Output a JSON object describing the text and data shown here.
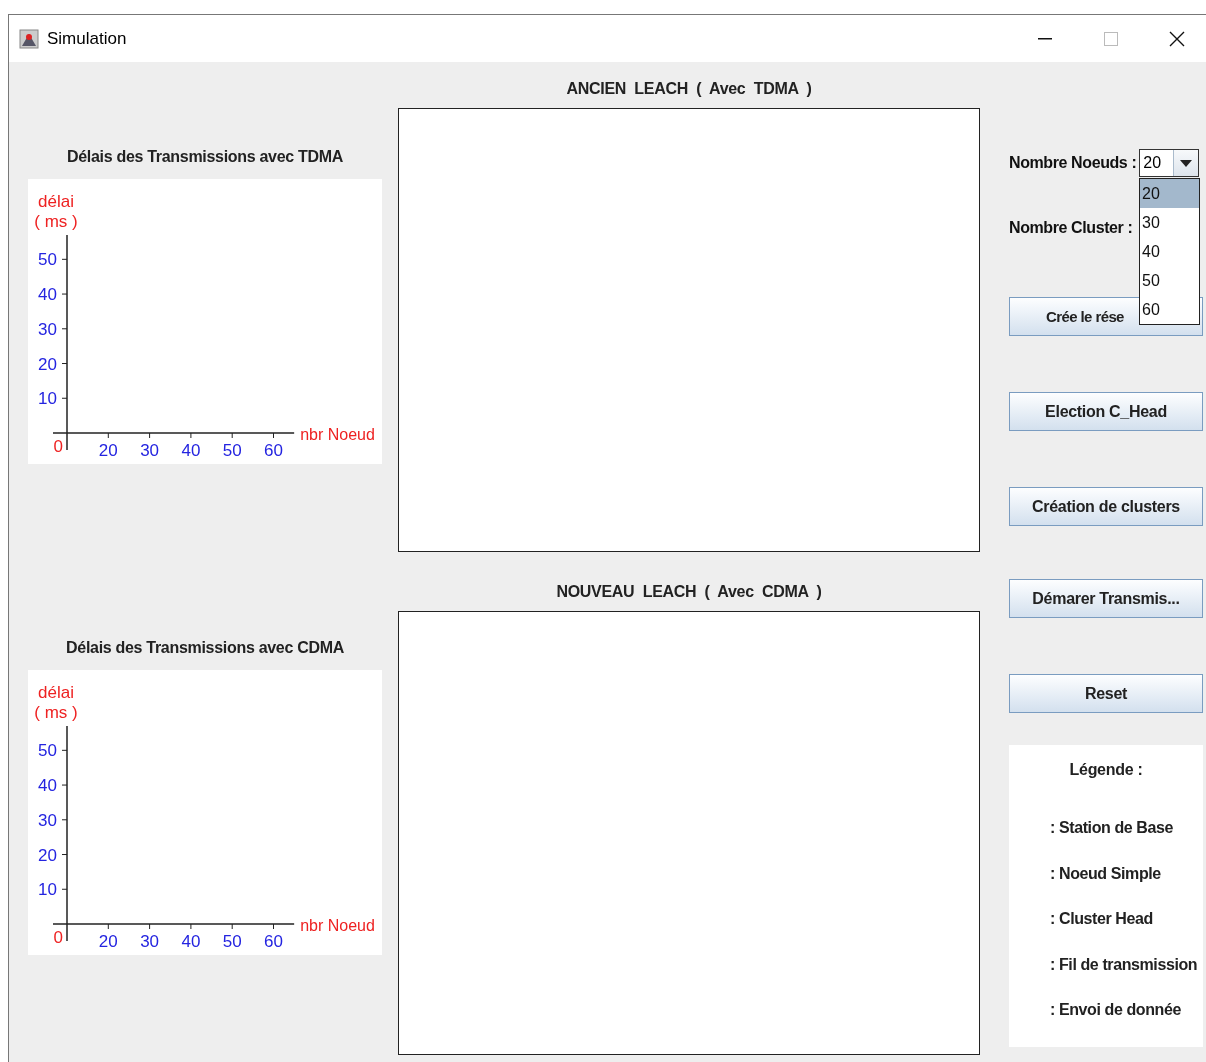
{
  "window": {
    "title": "Simulation"
  },
  "charts": [
    {
      "title": "Délais des Transmissions avec TDMA",
      "origin_label": "0",
      "chart_data": {
        "type": "line",
        "xlabel": "nbr Noeud",
        "ylabel": "délai\n( ms )",
        "xlim": [
          10,
          65
        ],
        "ylim": [
          0,
          57
        ],
        "xticks": [
          20,
          30,
          40,
          50,
          60
        ],
        "yticks": [
          10,
          20,
          30,
          40,
          50
        ]
      }
    },
    {
      "title": "Délais des Transmissions avec CDMA",
      "origin_label": "0",
      "chart_data": {
        "type": "line",
        "xlabel": "nbr Noeud",
        "ylabel": "délai\n( ms )",
        "xlim": [
          10,
          65
        ],
        "ylim": [
          0,
          57
        ],
        "xticks": [
          20,
          30,
          40,
          50,
          60
        ],
        "yticks": [
          10,
          20,
          30,
          40,
          50
        ]
      }
    }
  ],
  "panels": [
    {
      "title": "ANCIEN  LEACH  (  Avec  TDMA  )"
    },
    {
      "title": "NOUVEAU  LEACH  (  Avec  CDMA  )"
    }
  ],
  "nodes_field": {
    "label": "Nombre Noeuds :",
    "value": "20",
    "expanded": true,
    "options": [
      {
        "label": "20",
        "selected": true
      },
      {
        "label": "30",
        "selected": false
      },
      {
        "label": "40",
        "selected": false
      },
      {
        "label": "50",
        "selected": false
      },
      {
        "label": "60",
        "selected": false
      }
    ]
  },
  "cluster_field": {
    "label": "Nombre Cluster :"
  },
  "buttons": [
    "Crée le rése",
    "Election C_Head",
    "Création de clusters",
    "Démarer Transmis...",
    "Reset"
  ],
  "legend": {
    "title": "Légende :",
    "items": [
      ": Station de Base",
      ": Noeud Simple",
      ": Cluster Head",
      ": Fil de transmission",
      ": Envoi de donnée"
    ]
  }
}
